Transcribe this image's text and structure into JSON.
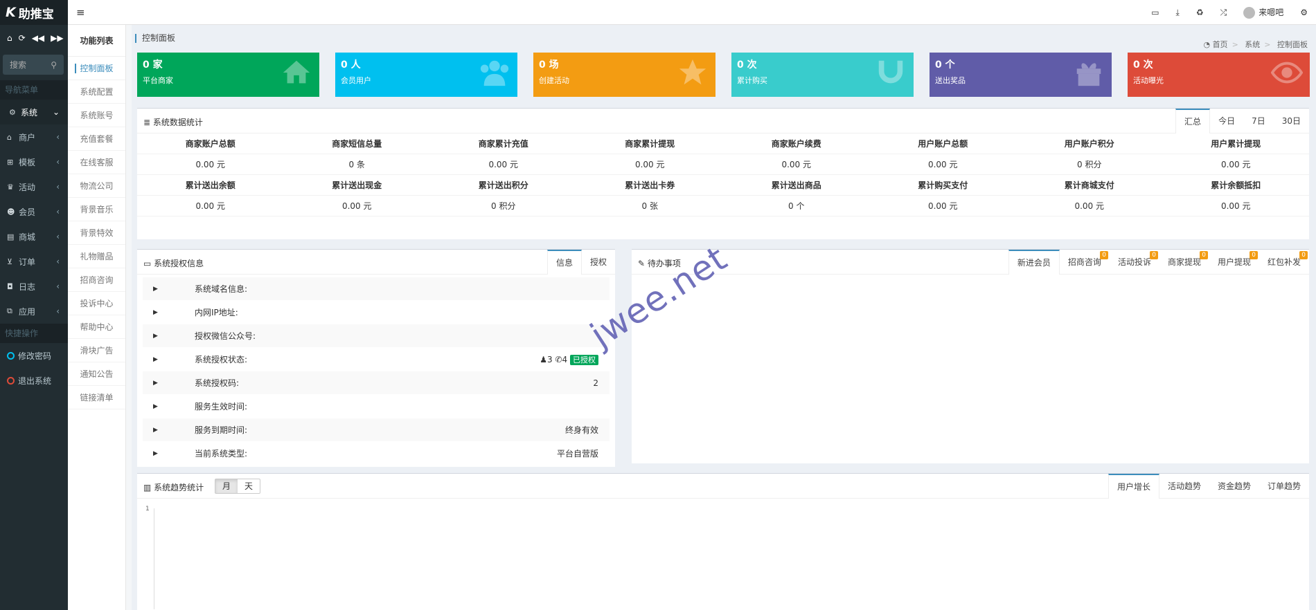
{
  "app": {
    "logo_mark": "K",
    "logo_text": "助推宝"
  },
  "sidebar": {
    "search_placeholder": "搜索",
    "nav_header": "导航菜单",
    "items": [
      {
        "label": "系统",
        "icon": "gear-icon",
        "active": true
      },
      {
        "label": "商户",
        "icon": "home-icon"
      },
      {
        "label": "模板",
        "icon": "sitemap-icon"
      },
      {
        "label": "活动",
        "icon": "trophy-icon"
      },
      {
        "label": "会员",
        "icon": "users-icon"
      },
      {
        "label": "商城",
        "icon": "shop-icon"
      },
      {
        "label": "订单",
        "icon": "cart-icon"
      },
      {
        "label": "日志",
        "icon": "shield-icon"
      },
      {
        "label": "应用",
        "icon": "cubes-icon"
      }
    ],
    "quick_header": "快捷操作",
    "quick": [
      {
        "label": "修改密码",
        "color": "#00c0ef"
      },
      {
        "label": "退出系统",
        "color": "#dd4b39"
      }
    ]
  },
  "topbar": {
    "username": "来嗯吧"
  },
  "submenu": {
    "title": "功能列表",
    "items": [
      "控制面板",
      "系统配置",
      "系统账号",
      "充值套餐",
      "在线客服",
      "物流公司",
      "背景音乐",
      "背景特效",
      "礼物赠品",
      "招商咨询",
      "投诉中心",
      "帮助中心",
      "滑块广告",
      "通知公告",
      "链接清单"
    ]
  },
  "page": {
    "title": "控制面板",
    "breadcrumb": [
      "首页",
      "系统",
      "控制面板"
    ]
  },
  "cards": [
    {
      "value": "0 家",
      "label": "平台商家",
      "color": "#00a65a"
    },
    {
      "value": "0 人",
      "label": "会员用户",
      "color": "#00c0ef"
    },
    {
      "value": "0 场",
      "label": "创建活动",
      "color": "#f39c12"
    },
    {
      "value": "0 次",
      "label": "累计购买",
      "color": "#39cccc"
    },
    {
      "value": "0 个",
      "label": "送出奖品",
      "color": "#605ca8"
    },
    {
      "value": "0 次",
      "label": "活动曝光",
      "color": "#dd4b39"
    }
  ],
  "stats": {
    "title": "系统数据统计",
    "tabs": [
      "汇总",
      "今日",
      "7日",
      "30日"
    ],
    "headers1": [
      "商家账户总额",
      "商家短信总量",
      "商家累计充值",
      "商家累计提现",
      "商家账户续费",
      "用户账户总额",
      "用户账户积分",
      "用户累计提现"
    ],
    "values1": [
      "0.00 元",
      "0 条",
      "0.00 元",
      "0.00 元",
      "0.00 元",
      "0.00 元",
      "0 积分",
      "0.00 元"
    ],
    "headers2": [
      "累计送出余额",
      "累计送出现金",
      "累计送出积分",
      "累计送出卡券",
      "累计送出商品",
      "累计购买支付",
      "累计商城支付",
      "累计余额抵扣"
    ],
    "values2": [
      "0.00 元",
      "0.00 元",
      "0 积分",
      "0 张",
      "0 个",
      "0.00 元",
      "0.00 元",
      "0.00 元"
    ]
  },
  "license": {
    "title": "系统授权信息",
    "tabs": [
      "信息",
      "授权"
    ],
    "rows": [
      {
        "label": "系统域名信息:",
        "value": ""
      },
      {
        "label": "内网IP地址:",
        "value": ""
      },
      {
        "label": "授权微信公众号:",
        "value": ""
      },
      {
        "label": "系统授权状态:",
        "value": "",
        "users": "3",
        "phones": "4",
        "badge": "已授权"
      },
      {
        "label": "系统授权码:",
        "value": "2"
      },
      {
        "label": "服务生效时间:",
        "value": ""
      },
      {
        "label": "服务到期时间:",
        "value": "终身有效"
      },
      {
        "label": "当前系统类型:",
        "value": "平台自营版"
      }
    ]
  },
  "todo": {
    "title": "待办事项",
    "tabs": [
      {
        "label": "新进会员",
        "badge": ""
      },
      {
        "label": "招商咨询",
        "badge": "0"
      },
      {
        "label": "活动投诉",
        "badge": "0"
      },
      {
        "label": "商家提现",
        "badge": "0"
      },
      {
        "label": "用户提现",
        "badge": "0"
      },
      {
        "label": "红包补发",
        "badge": "0"
      }
    ]
  },
  "trend": {
    "title": "系统趋势统计",
    "seg": [
      "月",
      "天"
    ],
    "tabs": [
      "用户增长",
      "活动趋势",
      "资金趋势",
      "订单趋势"
    ],
    "axis_tick": "1"
  },
  "watermark": "jwee.net"
}
